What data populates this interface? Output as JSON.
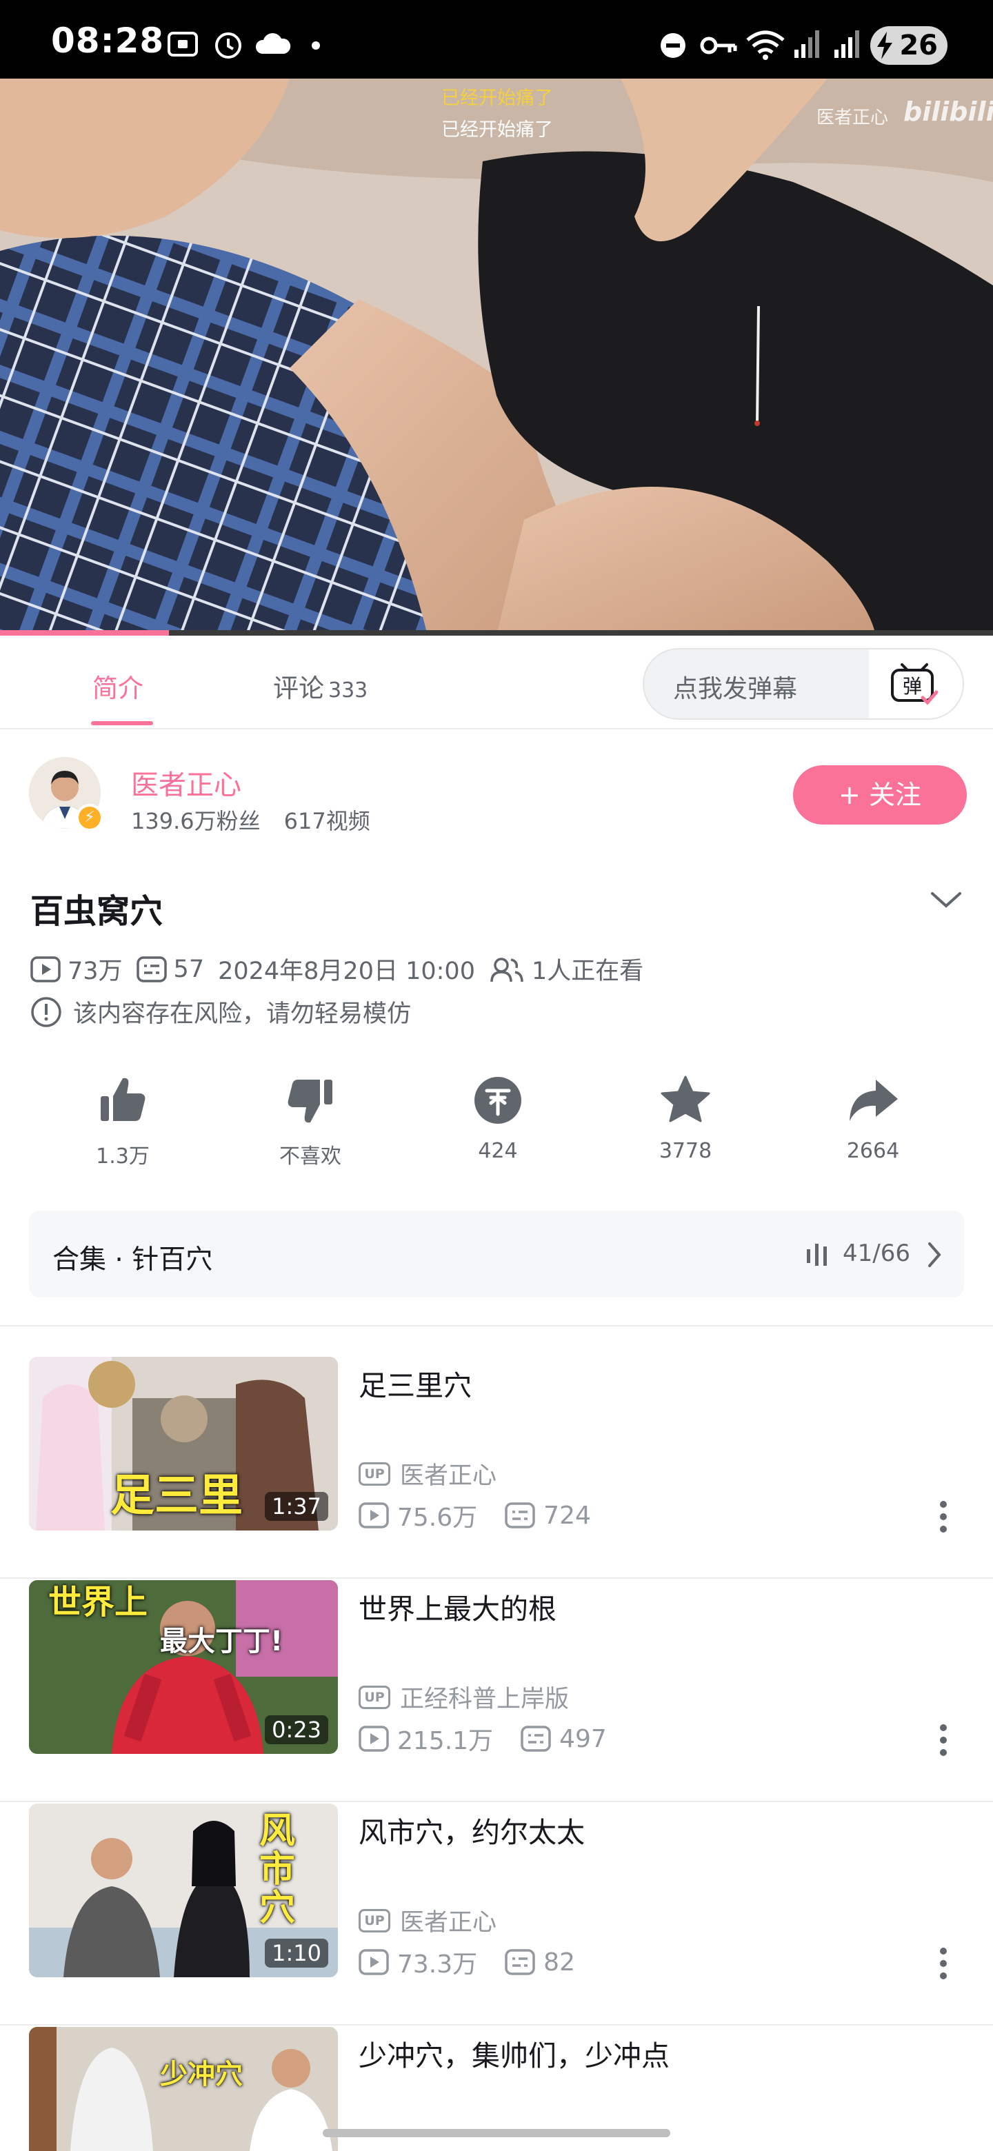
{
  "status_bar": {
    "time": "08:28",
    "battery": "26",
    "icons": [
      "screen-record-icon",
      "alarm-icon",
      "cloud-icon",
      "dot-icon",
      "dnd-icon",
      "vpn-key-icon",
      "wifi-icon",
      "signal-icon",
      "signal-icon",
      "battery-charging-icon"
    ]
  },
  "player": {
    "subtitle_line1": "已经开始痛了",
    "subtitle_line2": "已经开始痛了",
    "watermark": "医者正心",
    "watermark_logo": "bilibili",
    "progress": 0.17
  },
  "tabs": {
    "intro": "简介",
    "comments": "评论",
    "comments_count": "333",
    "danmaku_placeholder": "点我发弹幕",
    "danmaku_toggle": "弹"
  },
  "uploader": {
    "name": "医者正心",
    "fans": "139.6万粉丝",
    "videos": "617视频",
    "follow_label": "+ 关注"
  },
  "video": {
    "title": "百虫窝穴",
    "views": "73万",
    "danmaku": "57",
    "date": "2024年8月20日 10:00",
    "watching": "1人正在看",
    "warning": "该内容存在风险，请勿轻易模仿"
  },
  "actions": {
    "like": "1.3万",
    "dislike": "不喜欢",
    "coin": "424",
    "favorite": "3778",
    "share": "2664"
  },
  "collection": {
    "title": "合集 · 针百穴",
    "progress": "41/66"
  },
  "related": [
    {
      "title": "足三里穴",
      "up": "医者正心",
      "views": "75.6万",
      "danmaku": "724",
      "duration": "1:37",
      "thumb_text": "足三里"
    },
    {
      "title": "世界上最大的根",
      "up": "正经科普上岸版",
      "views": "215.1万",
      "danmaku": "497",
      "duration": "0:23",
      "thumb_text": "世界上",
      "thumb_text2": "最大丁丁!"
    },
    {
      "title": "风市穴，约尔太太",
      "up": "医者正心",
      "views": "73.3万",
      "danmaku": "82",
      "duration": "1:10",
      "thumb_text": "风市穴"
    },
    {
      "title": "少冲穴，集帅们，少冲点",
      "thumb_text": "少冲穴"
    }
  ],
  "colors": {
    "accent": "#fb7299",
    "text_primary": "#18191c",
    "text_secondary": "#61666d",
    "text_muted": "#9499a0"
  }
}
